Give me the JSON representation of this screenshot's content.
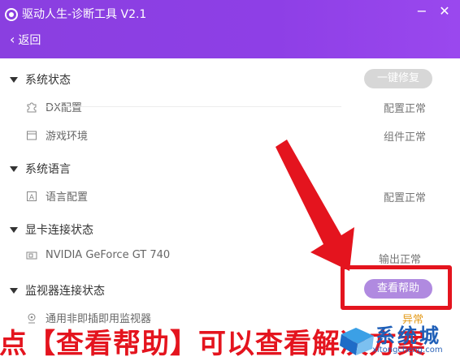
{
  "window": {
    "title": "驱动人生-诊断工具 V2.1",
    "minimize": "−",
    "close": "✕"
  },
  "nav": {
    "back_label": "返回"
  },
  "sections": [
    {
      "title": "系统状态",
      "action": "一键修复",
      "items": [
        {
          "label": "DX配置",
          "status": "配置正常",
          "icon": "puzzle-icon"
        },
        {
          "label": "游戏环境",
          "status": "组件正常",
          "icon": "window-icon"
        }
      ]
    },
    {
      "title": "系统语言",
      "items": [
        {
          "label": "语言配置",
          "status": "配置正常",
          "icon": "language-a-icon"
        }
      ]
    },
    {
      "title": "显卡连接状态",
      "items": [
        {
          "label": "NVIDIA GeForce GT 740",
          "status": "输出正常",
          "icon": "gpu-icon"
        }
      ]
    },
    {
      "title": "监视器连接状态",
      "action": "查看帮助",
      "items": [
        {
          "label": "通用非即插即用监视器",
          "status": "异常",
          "icon": "location-pin-icon"
        }
      ]
    }
  ],
  "caption": "点【查看帮助】可以查看解决方案",
  "watermark": {
    "text": "系统城",
    "sub": "xitongcheng.com"
  },
  "colors": {
    "titlebar": "#8e3fe6",
    "highlight": "#e4141e",
    "help_button": "#b08ae0"
  }
}
